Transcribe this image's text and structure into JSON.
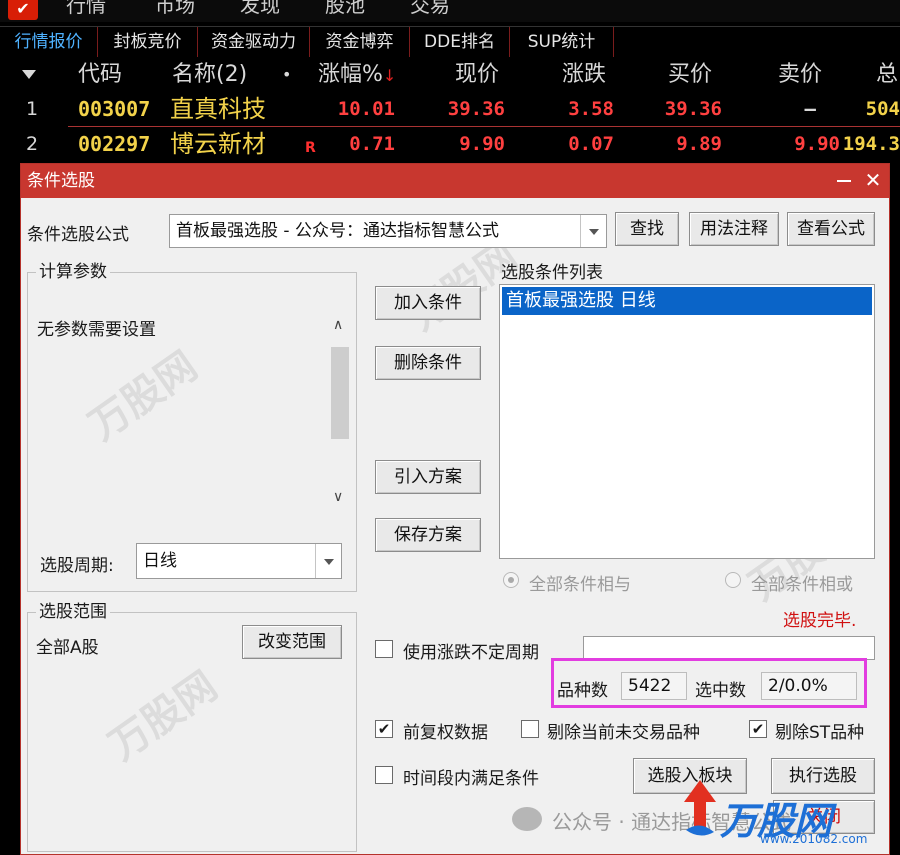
{
  "menubar": {
    "items": [
      "行情",
      "市场",
      "发现",
      "股池",
      "交易"
    ]
  },
  "tabs": [
    {
      "label": "行情报价",
      "active": true
    },
    {
      "label": "封板竞价",
      "active": false
    },
    {
      "label": "资金驱动力",
      "active": false
    },
    {
      "label": "资金博弈",
      "active": false
    },
    {
      "label": "DDE排名",
      "active": false
    },
    {
      "label": "SUP统计",
      "active": false
    }
  ],
  "grid": {
    "headers": {
      "code": "代码",
      "name": "名称(2)",
      "dot": "•",
      "change_pct": "涨幅%",
      "sort_arrow": "↓",
      "price": "现价",
      "change": "涨跌",
      "bid": "买价",
      "ask": "卖价",
      "total": "总"
    },
    "rows": [
      {
        "num": "1",
        "code": "003007",
        "name": "直真科技",
        "flag": "",
        "change_pct": "10.01",
        "price": "39.36",
        "change": "3.58",
        "bid": "39.36",
        "ask": "–",
        "total": "504"
      },
      {
        "num": "2",
        "code": "002297",
        "name": "博云新材",
        "flag": "R",
        "change_pct": "0.71",
        "price": "9.90",
        "change": "0.07",
        "bid": "9.89",
        "ask": "9.90",
        "total": "194.3"
      }
    ]
  },
  "dialog": {
    "title": "条件选股",
    "close_symbol": "✕",
    "formula_label": "条件选股公式",
    "formula_value": "首板最强选股  -  公众号：通达指标智慧公式",
    "btn_find": "查找",
    "btn_usage": "用法注释",
    "btn_view": "查看公式",
    "params_group": "计算参数",
    "params_text": "无参数需要设置",
    "cond_list_title": "选股条件列表",
    "cond_items": [
      "首板最强选股  日线"
    ],
    "btn_add": "加入条件",
    "btn_delete": "删除条件",
    "btn_import": "引入方案",
    "btn_save": "保存方案",
    "period_label": "选股周期:",
    "period_value": "日线",
    "radio_and": "全部条件相与",
    "radio_or": "全部条件相或",
    "status": "选股完毕.",
    "range_group": "选股范围",
    "range_value": "全部A股",
    "btn_change_range": "改变范围",
    "chk_uncertain_period": "使用涨跌不定周期",
    "count_label": "品种数",
    "count_value": "5422",
    "selected_label": "选中数",
    "selected_value": "2/0.0%",
    "chk_prev_adjust": "前复权数据",
    "chk_remove_untraded": "剔除当前未交易品种",
    "chk_remove_st": "剔除ST品种",
    "chk_time_range": "时间段内满足条件",
    "btn_to_block": "选股入板块",
    "btn_execute": "执行选股",
    "btn_close": "关闭"
  },
  "watermark": {
    "bottom_text": "公众号 · 通达指标智慧公式",
    "brand": "万股网",
    "url": "www.201082.com"
  },
  "colors": {
    "dialog_title_bg": "#c8372f",
    "selected_item_bg": "#0a64c8",
    "highlight_box": "#e23de0",
    "quote_up": "#ff4040",
    "quote_name": "#f2d24a",
    "tab_active": "#4fb2ff"
  }
}
